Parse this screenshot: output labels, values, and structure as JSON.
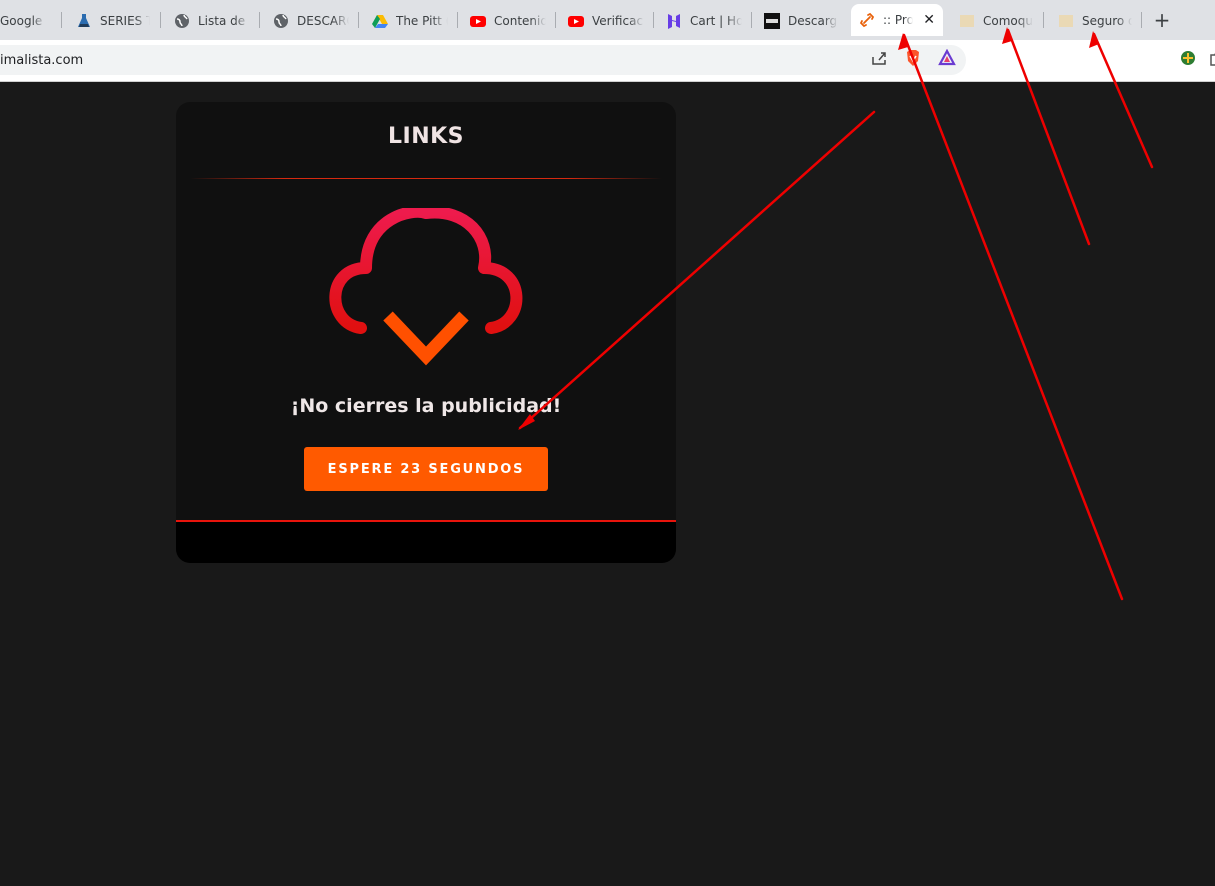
{
  "browser": {
    "tabs": [
      {
        "title": "Google D",
        "icon": "page-icon"
      },
      {
        "title": "SERIES TV",
        "icon": "flask-icon"
      },
      {
        "title": "Lista de p",
        "icon": "globe-icon"
      },
      {
        "title": "DESCARG",
        "icon": "globe-icon"
      },
      {
        "title": "The Pitt (",
        "icon": "drive-icon"
      },
      {
        "title": "Contenid",
        "icon": "youtube-icon"
      },
      {
        "title": "Verificaci",
        "icon": "youtube-icon"
      },
      {
        "title": "Cart | Ho",
        "icon": "hostinger-icon"
      },
      {
        "title": "Descarga",
        "icon": "site-logo-icon"
      },
      {
        "title": ":: Pro",
        "icon": "link-icon",
        "active": true
      },
      {
        "title": "Comoqu",
        "icon": "folder-icon"
      },
      {
        "title": "Seguro d",
        "icon": "folder-icon"
      }
    ],
    "close_tab": "✕",
    "new_tab": "+",
    "address": "imalista.com"
  },
  "page": {
    "card_title": "LINKS",
    "notice": "¡No cierres la publicidad!",
    "wait_button": "ESPERE 23 SEGUNDOS"
  },
  "colors": {
    "page_bg": "#191919",
    "card_bg": "#101010",
    "button": "#ff5a00",
    "accent_red": "#e8140c",
    "annotation_arrows": "#ee0000"
  }
}
